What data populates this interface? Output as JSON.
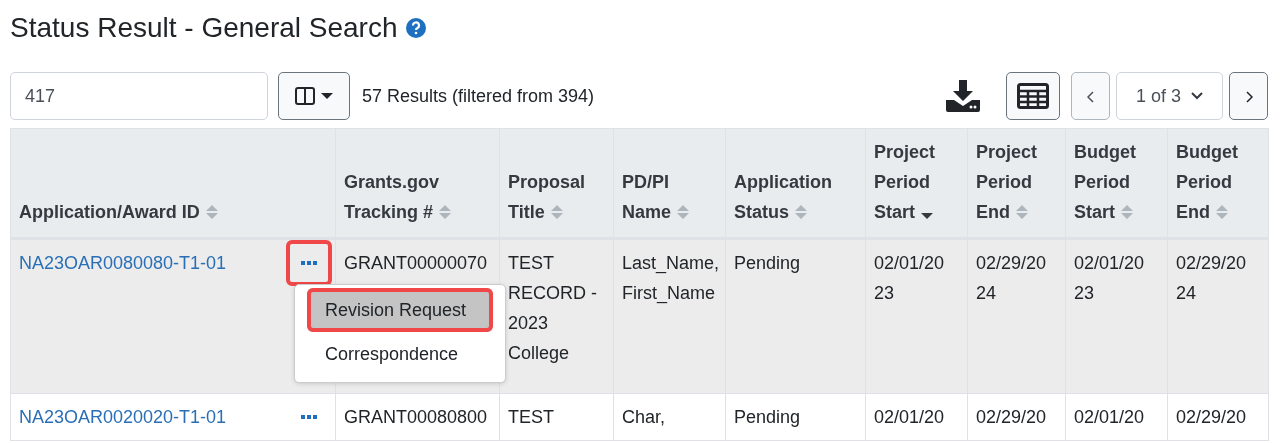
{
  "title": "Status Result - General Search",
  "search": {
    "value": "417"
  },
  "results_text": "57 Results (filtered from 394)",
  "pager": {
    "page": "1 of 3"
  },
  "table": {
    "columns": [
      {
        "label": "Application/Award ID",
        "sorted": false
      },
      {
        "label": "Grants.gov Tracking #",
        "sorted": false
      },
      {
        "label": "Proposal Title",
        "sorted": false
      },
      {
        "label": "PD/PI Name",
        "sorted": false
      },
      {
        "label": "Application Status",
        "sorted": false
      },
      {
        "label": "Project Period Start",
        "sorted": true
      },
      {
        "label": "Project Period End",
        "sorted": false
      },
      {
        "label": "Budget Period Start",
        "sorted": false
      },
      {
        "label": "Budget Period End",
        "sorted": false
      }
    ],
    "rows": [
      {
        "selected": true,
        "actions_highlighted": true,
        "menu": {
          "items": [
            {
              "label": "Revision Request",
              "selected": true,
              "highlighted": true
            },
            {
              "label": "Correspondence",
              "selected": false,
              "highlighted": false
            }
          ]
        },
        "cells": [
          "NA23OAR0080080-T1-01",
          "GRANT00000070",
          "TEST RECORD - 2023 College",
          "Last_Name, First_Name",
          "Pending",
          "02/01/2023",
          "02/29/2024",
          "02/01/2023",
          "02/29/2024"
        ]
      },
      {
        "selected": false,
        "actions_highlighted": false,
        "cells": [
          "NA23OAR0020020-T1-01",
          "GRANT00080800",
          "TEST",
          "Char,",
          "Pending",
          "02/01/20",
          "02/29/20",
          "02/01/20",
          "02/29/20"
        ]
      }
    ]
  }
}
